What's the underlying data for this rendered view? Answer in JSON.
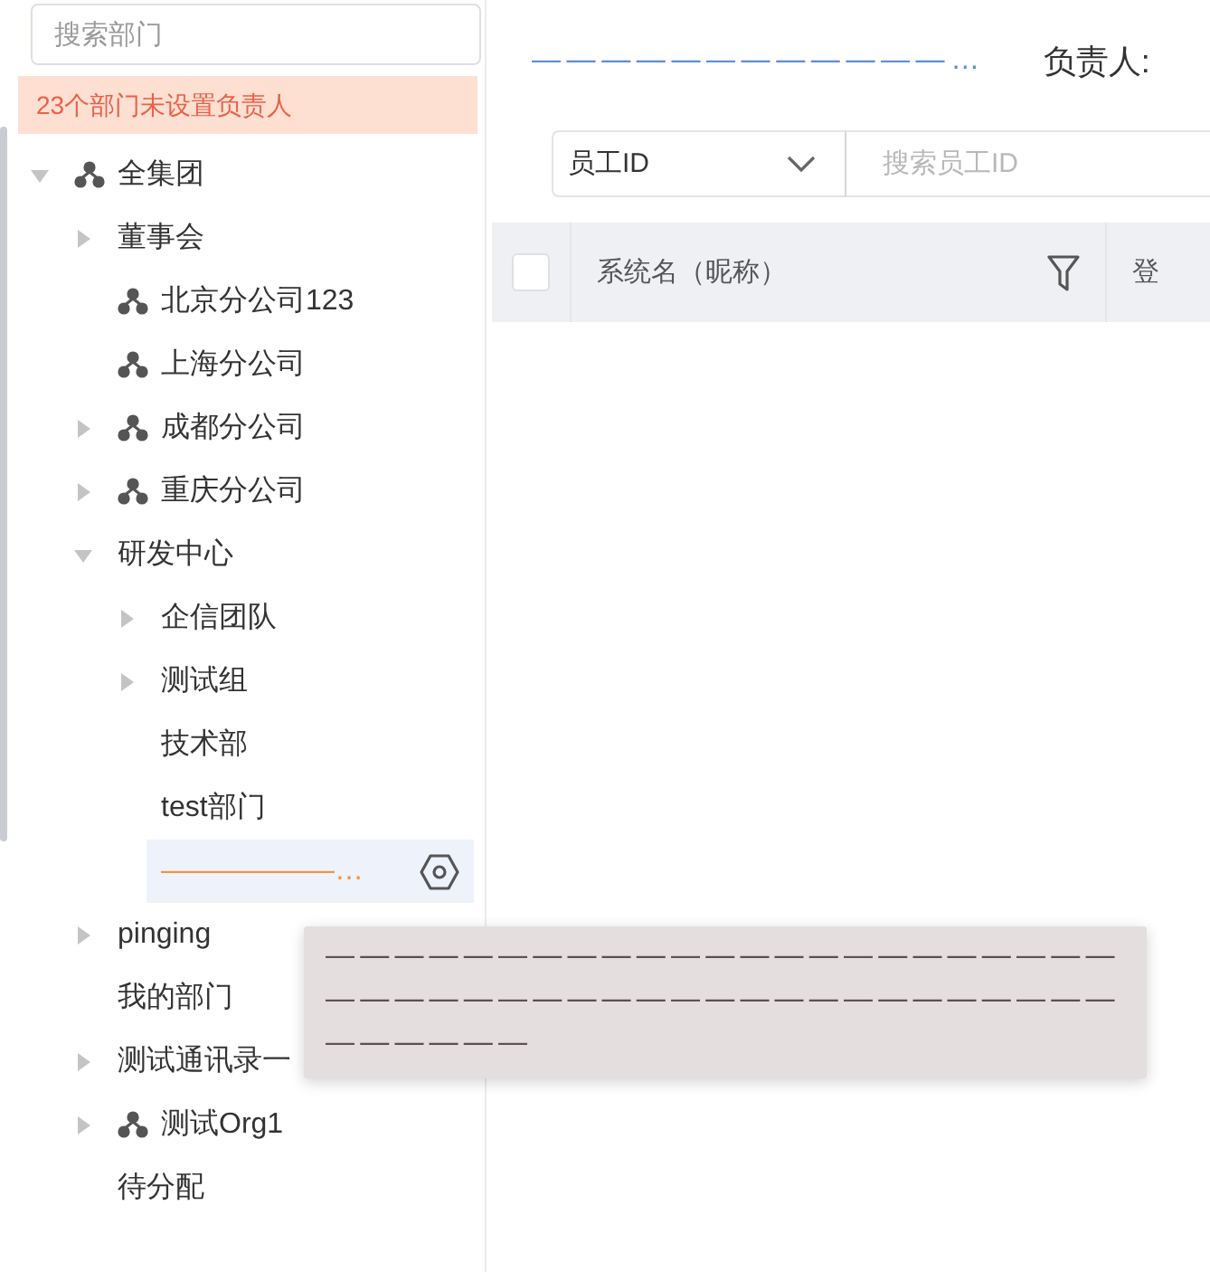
{
  "sidebar": {
    "search": {
      "placeholder": "搜索部门"
    },
    "notice": "23个部门未设置负责人",
    "tree": [
      {
        "label": "全集团",
        "org_icon": true,
        "expanded": true,
        "selected": false,
        "children": [
          {
            "label": "董事会",
            "org_icon": false,
            "expanded": false,
            "selected": false
          },
          {
            "label": "北京分公司123",
            "org_icon": true,
            "selected": false
          },
          {
            "label": "上海分公司",
            "org_icon": true,
            "selected": false
          },
          {
            "label": "成都分公司",
            "org_icon": true,
            "expanded": false,
            "selected": false
          },
          {
            "label": "重庆分公司",
            "org_icon": true,
            "expanded": false,
            "selected": false
          },
          {
            "label": "研发中心",
            "org_icon": false,
            "expanded": true,
            "selected": false,
            "children": [
              {
                "label": "企信团队",
                "org_icon": false,
                "expanded": false,
                "selected": false
              },
              {
                "label": "测试组",
                "org_icon": false,
                "expanded": false,
                "selected": false
              },
              {
                "label": "技术部",
                "org_icon": false,
                "selected": false
              },
              {
                "label": "test部门",
                "org_icon": false,
                "selected": false
              },
              {
                "label": "——————…",
                "org_icon": false,
                "selected": true
              }
            ]
          },
          {
            "label": "pinging",
            "org_icon": false,
            "expanded": false,
            "selected": false
          },
          {
            "label": "我的部门",
            "org_icon": false,
            "selected": false
          },
          {
            "label": "测试通讯录一",
            "org_icon": false,
            "expanded": false,
            "selected": false
          },
          {
            "label": "测试Org1",
            "org_icon": true,
            "expanded": false,
            "selected": false
          },
          {
            "label": "待分配",
            "org_icon": false,
            "selected": false
          }
        ]
      }
    ],
    "tooltip": [
      "———————————————————————",
      "———————————————————————",
      "——————"
    ]
  },
  "main": {
    "title": "————————————…",
    "manager_label": "负责人:",
    "filter": {
      "field": "员工ID",
      "placeholder": "搜索员工ID"
    },
    "table": {
      "columns": [
        {
          "kind": "checkbox",
          "checked": false
        },
        {
          "kind": "text",
          "label": "系统名（昵称）",
          "filter": true
        },
        {
          "kind": "text",
          "label": "登",
          "filter": false
        }
      ]
    }
  }
}
